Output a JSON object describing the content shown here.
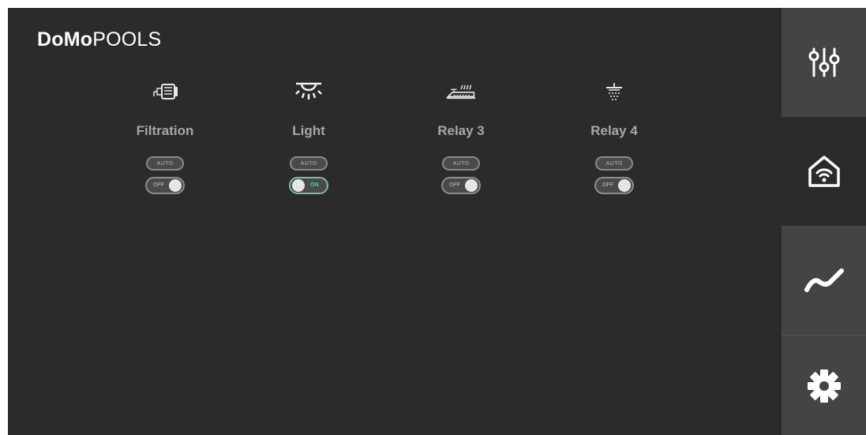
{
  "app": {
    "logo_bold": "DoMo",
    "logo_regular": "POOLS"
  },
  "devices": [
    {
      "label": "Filtration",
      "icon": "pump-motor-icon",
      "auto_label": "AUTO",
      "state": "off",
      "state_label": "OFF"
    },
    {
      "label": "Light",
      "icon": "pool-light-icon",
      "auto_label": "AUTO",
      "state": "on",
      "state_label": "ON"
    },
    {
      "label": "Relay 3",
      "icon": "heater-icon",
      "auto_label": "AUTO",
      "state": "off",
      "state_label": "OFF"
    },
    {
      "label": "Relay 4",
      "icon": "sprinkler-icon",
      "auto_label": "AUTO",
      "state": "off",
      "state_label": "OFF"
    }
  ],
  "sidebar": {
    "items": [
      {
        "icon": "sliders-icon"
      },
      {
        "icon": "smart-home-icon",
        "active": true
      },
      {
        "icon": "chart-trend-icon"
      },
      {
        "icon": "gear-icon"
      }
    ]
  },
  "colors": {
    "background": "#2b2b2b",
    "sidebar_button": "#444444",
    "on_accent": "#3fd1b4",
    "label_gray": "#a7a7a7"
  }
}
